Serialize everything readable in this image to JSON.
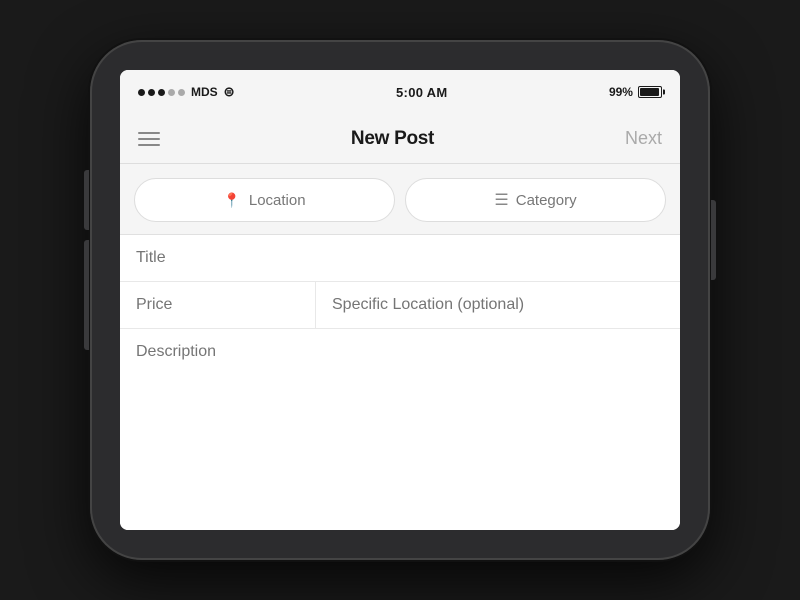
{
  "status_bar": {
    "carrier": "MDS",
    "time": "5:00 AM",
    "battery_percent": "99%"
  },
  "nav": {
    "title": "New Post",
    "next_label": "Next"
  },
  "filters": {
    "location_label": "Location",
    "category_label": "Category"
  },
  "form": {
    "title_placeholder": "Title",
    "price_placeholder": "Price",
    "specific_location_placeholder": "Specific Location (optional)",
    "description_placeholder": "Description"
  },
  "icons": {
    "location_pin": "📍",
    "category": "≡",
    "hamburger": "hamburger"
  }
}
